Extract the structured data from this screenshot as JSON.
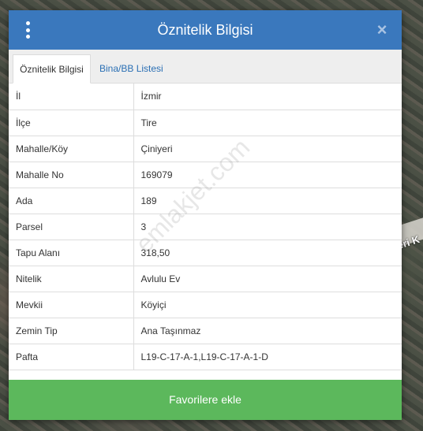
{
  "dialog": {
    "title": "Öznitelik Bilgisi",
    "close_symbol": "×",
    "menu_icon": "vertical-ellipsis-icon",
    "close_icon": "close-icon"
  },
  "tabs": [
    {
      "label": "Öznitelik Bilgisi",
      "active": true
    },
    {
      "label": "Bina/BB Listesi",
      "active": false
    }
  ],
  "attributes": [
    {
      "key": "İl",
      "value": "İzmir"
    },
    {
      "key": "İlçe",
      "value": "Tire"
    },
    {
      "key": "Mahalle/Köy",
      "value": "Çiniyeri"
    },
    {
      "key": "Mahalle No",
      "value": "169079"
    },
    {
      "key": "Ada",
      "value": "189"
    },
    {
      "key": "Parsel",
      "value": "3"
    },
    {
      "key": "Tapu Alanı",
      "value": "318,50"
    },
    {
      "key": "Nitelik",
      "value": "Avlulu Ev"
    },
    {
      "key": "Mevkii",
      "value": "Köyiçi"
    },
    {
      "key": "Zemin Tip",
      "value": "Ana Taşınmaz"
    },
    {
      "key": "Pafta",
      "value": "L19-C-17-A-1,L19-C-17-A-1-D"
    }
  ],
  "favorite_button": "Favorilere ekle",
  "watermark": "emlakjet.com",
  "map_label": "eri K",
  "colors": {
    "header": "#3a78bd",
    "button": "#5cb85c",
    "tab_link": "#2a6fb4"
  }
}
